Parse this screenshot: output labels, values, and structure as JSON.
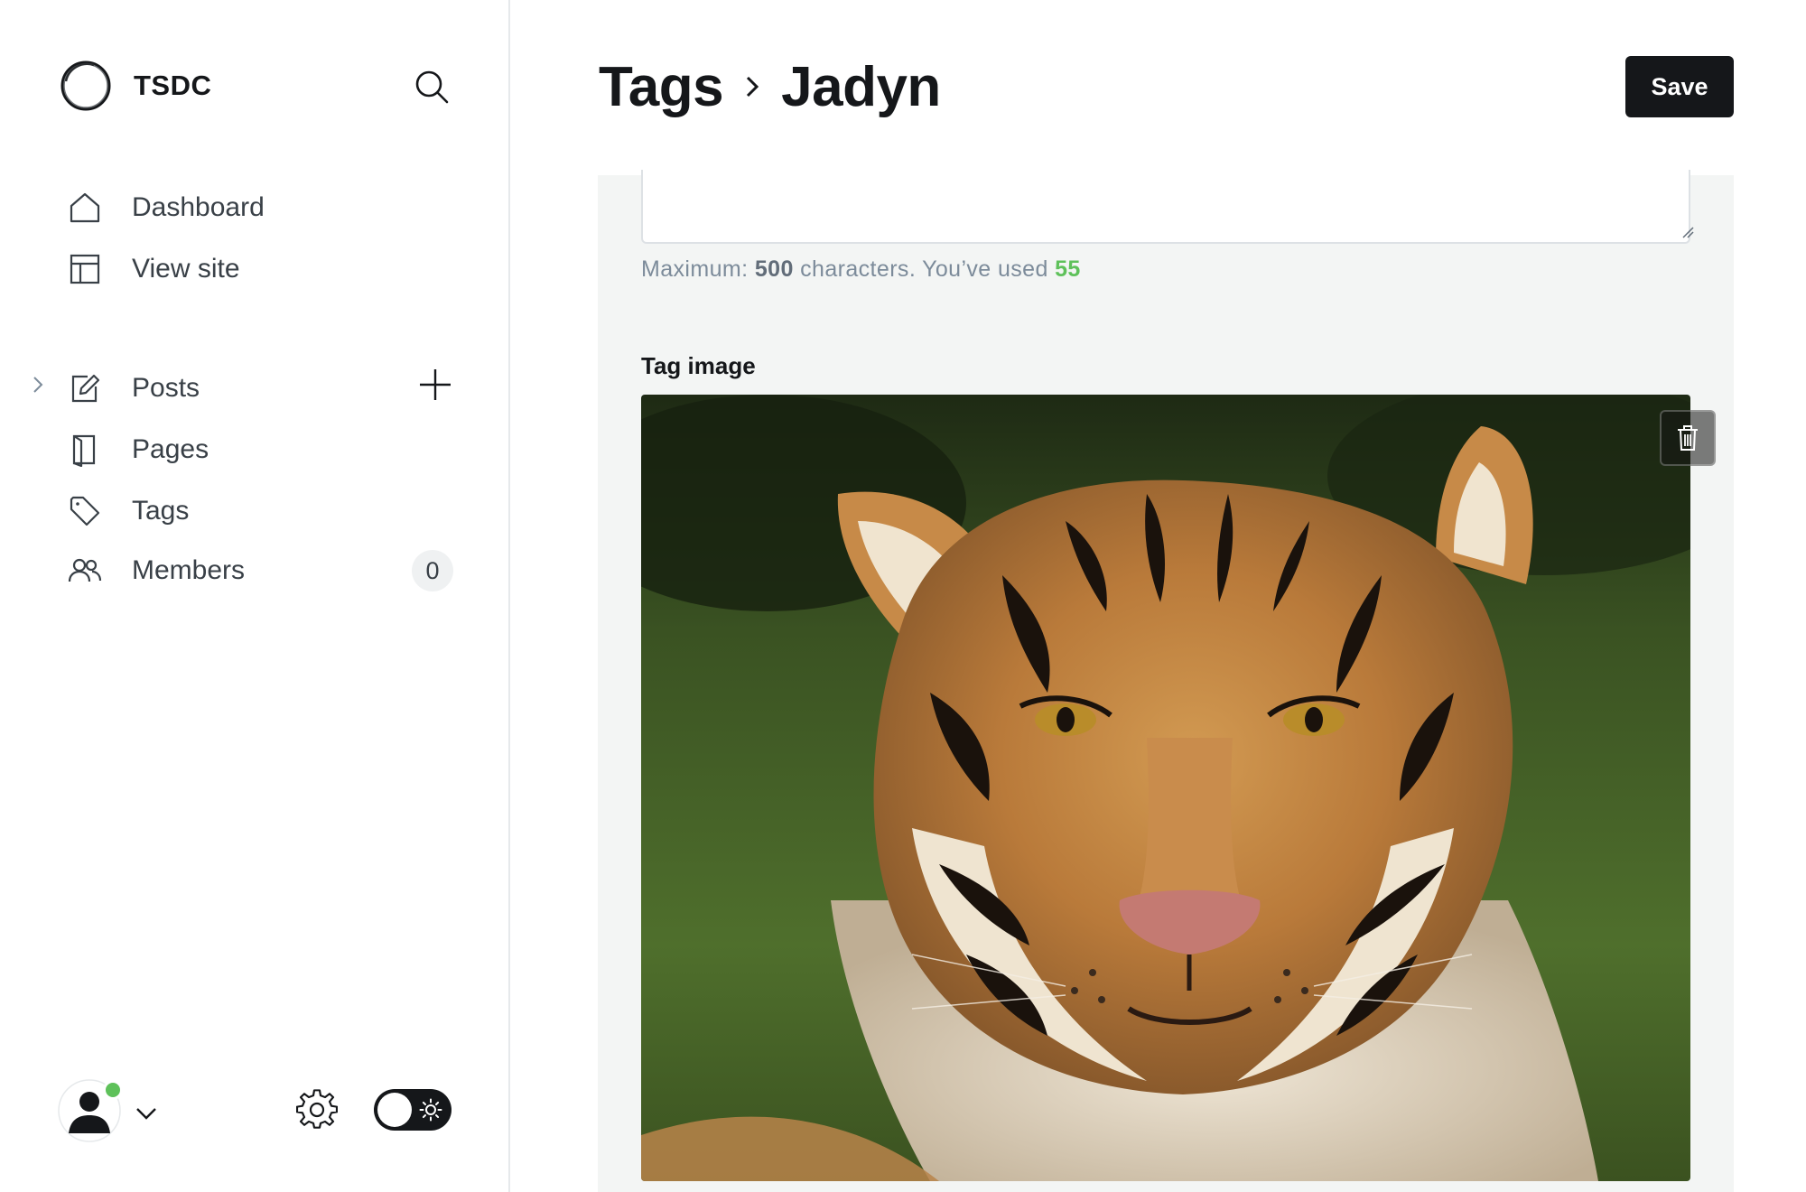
{
  "sidebar": {
    "brand": {
      "name": "TSDC",
      "logo_icon": "ring-logo"
    },
    "search_icon": "search-icon",
    "items": [
      {
        "label": "Dashboard",
        "icon": "home-icon"
      },
      {
        "label": "View site",
        "icon": "layout-icon"
      },
      {
        "label": "Posts",
        "icon": "edit-icon"
      },
      {
        "label": "Pages",
        "icon": "page-icon"
      },
      {
        "label": "Tags",
        "icon": "tag-icon"
      },
      {
        "label": "Members",
        "icon": "members-icon",
        "count": "0"
      }
    ],
    "footer": {
      "avatar_icon": "user-avatar-icon",
      "status": "online",
      "settings_icon": "gear-icon",
      "theme_toggle": "dark-mode-toggle"
    }
  },
  "header": {
    "breadcrumb_parent": "Tags",
    "breadcrumb_current": "Jadyn",
    "save_label": "Save"
  },
  "form": {
    "description_value": "",
    "char_hint": {
      "prefix": "Maximum: ",
      "max": "500",
      "middle": " characters. You’ve used ",
      "used": "55"
    },
    "tag_image_label": "Tag image",
    "tag_image_subject": "tiger portrait"
  },
  "colors": {
    "accent_green": "#5ec15a",
    "dark": "#15171a",
    "panel_bg": "#f3f5f4"
  }
}
